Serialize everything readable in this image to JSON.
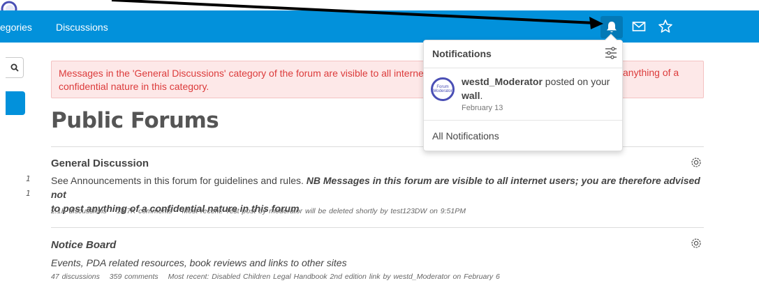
{
  "topnav": {
    "categories": "egories",
    "discussions": "Discussions"
  },
  "icons": {
    "bell": "bell-icon",
    "mail": "mail-icon",
    "star": "star-icon",
    "avatar": "user-avatar",
    "search": "search-icon",
    "gear": "gear-icon",
    "filter": "sliders-icon"
  },
  "colors": {
    "brand": "#0291db",
    "alert_text": "#dc3b3b",
    "alert_bg": "#fde8e8"
  },
  "sidebar": {
    "counts": [
      "1",
      "1"
    ]
  },
  "alert": {
    "text": "Messages in the 'General Discussions' category of the forum are visible to all interne",
    "text_right": "anything of a",
    "text_line2": "confidential nature in this category."
  },
  "page": {
    "title": "Public Forums"
  },
  "categories": [
    {
      "title": "General Discussion",
      "desc_plain": "See Announcements in this forum for guidelines and rules. ",
      "desc_bold_1": "NB Messages in this forum are visible to all internet users; you are therefore advised not",
      "desc_bold_2": "to post anything of a confidential nature in this forum",
      "discussions": "2.1K discussions",
      "comments": "14.7K comments",
      "recent": "Most recent: Test post by moderator will be deleted shortly by test123DW on 9:51PM"
    },
    {
      "title": "Notice Board",
      "desc": "Events, PDA related resources, book reviews and links to other sites",
      "discussions": "47 discussions",
      "comments": "359 comments",
      "recent": "Most recent: Disabled Children Legal Handbook 2nd edition link by westd_Moderator on February 6"
    }
  ],
  "notifications": {
    "title": "Notifications",
    "avatar_text": "Forum Moderator",
    "item_user": "westd_Moderator",
    "item_mid": " posted on your ",
    "item_target": "wall",
    "item_end": ".",
    "item_date": "February 13",
    "all_link": "All Notifications"
  }
}
